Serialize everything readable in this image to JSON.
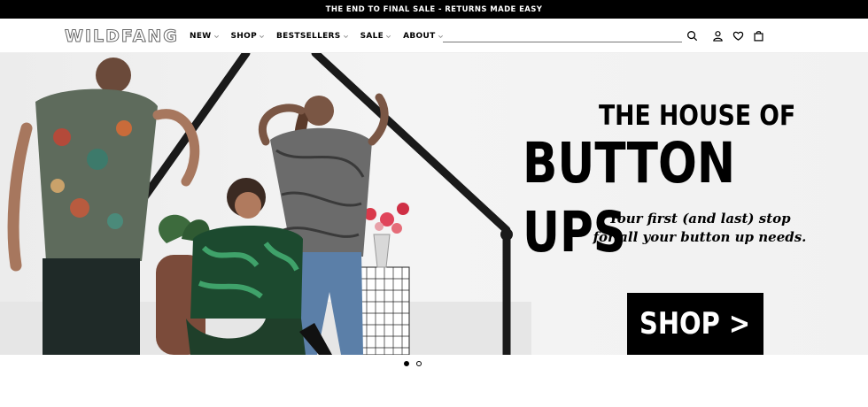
{
  "announcement": "THE END TO FINAL SALE - RETURNS MADE EASY",
  "logo": "WILDFANG",
  "nav": [
    {
      "label": "NEW"
    },
    {
      "label": "SHOP"
    },
    {
      "label": "BESTSELLERS"
    },
    {
      "label": "SALE"
    },
    {
      "label": "ABOUT"
    }
  ],
  "icons": [
    "search-icon",
    "account-icon",
    "wishlist-icon",
    "cart-icon"
  ],
  "hero": {
    "headline_line1": "THE HOUSE OF",
    "headline_line2": "BUTTON UPS",
    "subline_1": "Your first (and last) stop",
    "subline_2": "for all your button up needs.",
    "cta": "SHOP >"
  },
  "carousel": {
    "slides": 2,
    "active": 1
  },
  "colors": {
    "accent": "#000000",
    "background": "#ffffff"
  }
}
